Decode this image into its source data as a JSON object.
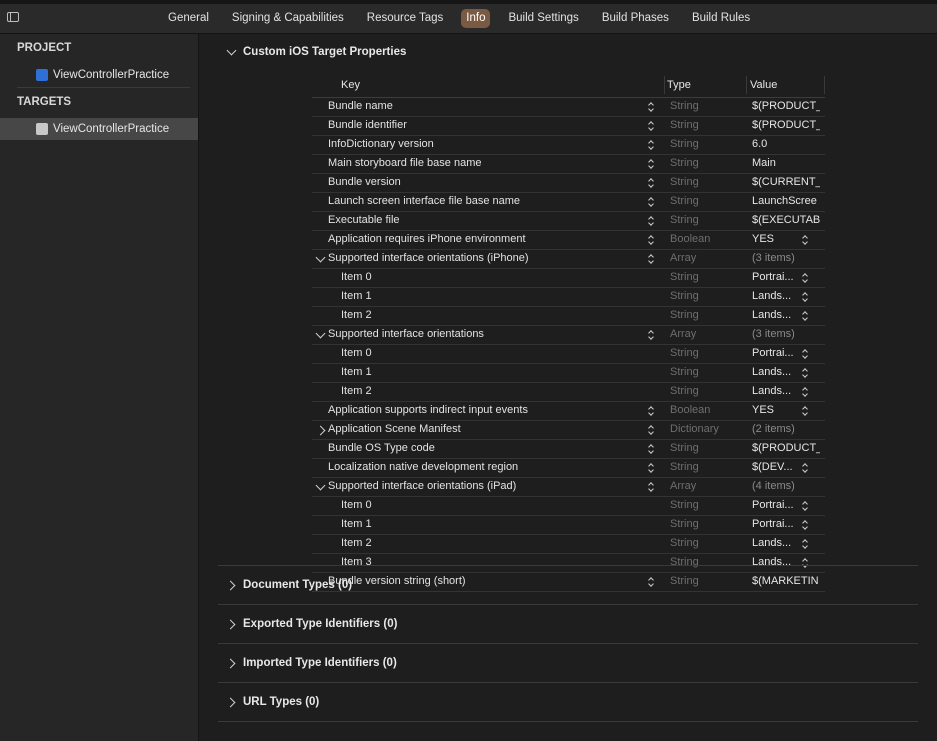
{
  "tabs": [
    "General",
    "Signing & Capabilities",
    "Resource Tags",
    "Info",
    "Build Settings",
    "Build Phases",
    "Build Rules"
  ],
  "active_tab": "Info",
  "sidebar": {
    "project_header": "PROJECT",
    "project_item": "ViewControllerPractice",
    "targets_header": "TARGETS",
    "target_item": "ViewControllerPractice"
  },
  "sections": {
    "custom": "Custom iOS Target Properties",
    "document_types": "Document Types (0)",
    "exported": "Exported Type Identifiers (0)",
    "imported": "Imported Type Identifiers (0)",
    "url_types": "URL Types (0)"
  },
  "plist": {
    "headers": {
      "key": "Key",
      "type": "Type",
      "value": "Value"
    },
    "rows": [
      {
        "key": "Bundle name",
        "type": "String",
        "value": "$(PRODUCT_",
        "level": 0
      },
      {
        "key": "Bundle identifier",
        "type": "String",
        "value": "$(PRODUCT_",
        "level": 0
      },
      {
        "key": "InfoDictionary version",
        "type": "String",
        "value": "6.0",
        "level": 0
      },
      {
        "key": "Main storyboard file base name",
        "type": "String",
        "value": "Main",
        "level": 0
      },
      {
        "key": "Bundle version",
        "type": "String",
        "value": "$(CURRENT_",
        "level": 0
      },
      {
        "key": "Launch screen interface file base name",
        "type": "String",
        "value": "LaunchScree",
        "level": 0
      },
      {
        "key": "Executable file",
        "type": "String",
        "value": "$(EXECUTAB",
        "level": 0
      },
      {
        "key": "Application requires iPhone environment",
        "type": "Boolean",
        "value": "YES",
        "level": 0,
        "value_stepper": true
      },
      {
        "key": "Supported interface orientations (iPhone)",
        "type": "Array",
        "value": "(3 items)",
        "level": 0,
        "expand": "open"
      },
      {
        "key": "Item 0",
        "type": "String",
        "value": "Portrai...",
        "level": 1,
        "value_stepper": true
      },
      {
        "key": "Item 1",
        "type": "String",
        "value": "Lands...",
        "level": 1,
        "value_stepper": true
      },
      {
        "key": "Item 2",
        "type": "String",
        "value": "Lands...",
        "level": 1,
        "value_stepper": true
      },
      {
        "key": "Supported interface orientations",
        "type": "Array",
        "value": "(3 items)",
        "level": 0,
        "expand": "open"
      },
      {
        "key": "Item 0",
        "type": "String",
        "value": "Portrai...",
        "level": 1,
        "value_stepper": true
      },
      {
        "key": "Item 1",
        "type": "String",
        "value": "Lands...",
        "level": 1,
        "value_stepper": true
      },
      {
        "key": "Item 2",
        "type": "String",
        "value": "Lands...",
        "level": 1,
        "value_stepper": true
      },
      {
        "key": "Application supports indirect input events",
        "type": "Boolean",
        "value": "YES",
        "level": 0,
        "value_stepper": true
      },
      {
        "key": "Application Scene Manifest",
        "type": "Dictionary",
        "value": "(2 items)",
        "level": 0,
        "expand": "closed"
      },
      {
        "key": "Bundle OS Type code",
        "type": "String",
        "value": "$(PRODUCT_",
        "level": 0
      },
      {
        "key": "Localization native development region",
        "type": "String",
        "value": "$(DEV...",
        "level": 0,
        "value_stepper": true
      },
      {
        "key": "Supported interface orientations (iPad)",
        "type": "Array",
        "value": "(4 items)",
        "level": 0,
        "expand": "open"
      },
      {
        "key": "Item 0",
        "type": "String",
        "value": "Portrai...",
        "level": 1,
        "value_stepper": true
      },
      {
        "key": "Item 1",
        "type": "String",
        "value": "Portrai...",
        "level": 1,
        "value_stepper": true
      },
      {
        "key": "Item 2",
        "type": "String",
        "value": "Lands...",
        "level": 1,
        "value_stepper": true
      },
      {
        "key": "Item 3",
        "type": "String",
        "value": "Lands...",
        "level": 1,
        "value_stepper": true
      },
      {
        "key": "Bundle version string (short)",
        "type": "String",
        "value": "$(MARKETIN",
        "level": 0
      }
    ]
  },
  "colors": {
    "accent_tab": "#7a5a42",
    "background": "#1e1e1e",
    "sidebar": "#262626",
    "selection": "#474747"
  }
}
